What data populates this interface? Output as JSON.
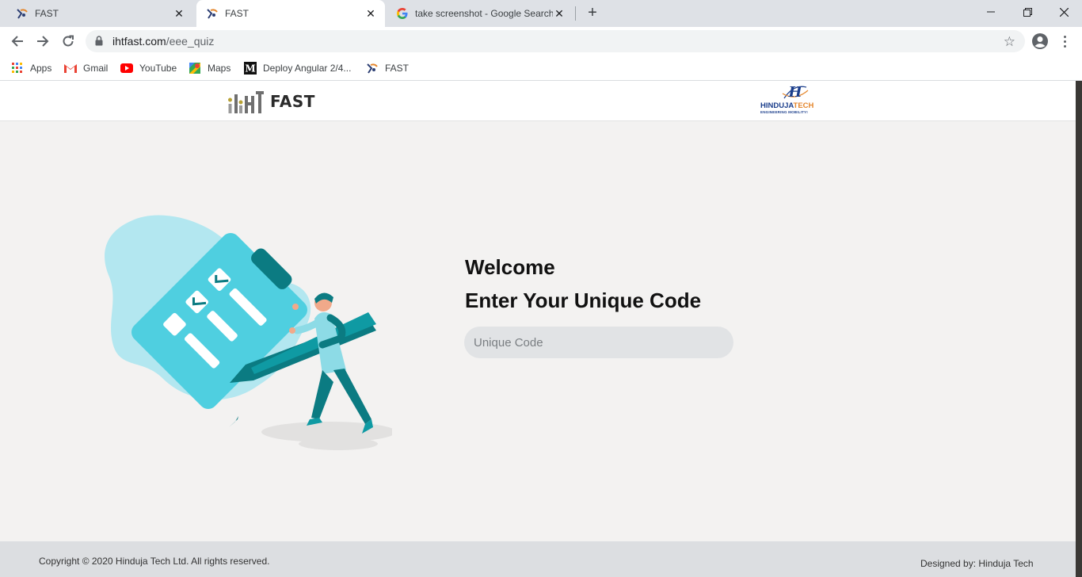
{
  "browser": {
    "tabs": [
      {
        "title": "FAST",
        "favicon": "fast-logo-icon",
        "active": false
      },
      {
        "title": "FAST",
        "favicon": "fast-logo-icon",
        "active": true
      },
      {
        "title": "take screenshot - Google Search",
        "favicon": "google-icon",
        "active": false
      }
    ],
    "close_glyph": "✕",
    "new_tab_glyph": "+",
    "url_domain": "ihtfast.com",
    "url_path": "/eee_quiz",
    "bookmarks": [
      {
        "label": "Apps",
        "icon": "apps-grid-icon"
      },
      {
        "label": "Gmail",
        "icon": "gmail-icon"
      },
      {
        "label": "YouTube",
        "icon": "youtube-icon"
      },
      {
        "label": "Maps",
        "icon": "maps-icon"
      },
      {
        "label": "Deploy Angular 2/4...",
        "icon": "medium-icon"
      },
      {
        "label": "FAST",
        "icon": "fast-logo-icon"
      }
    ]
  },
  "header": {
    "logo_text": "FAST",
    "partner_brand": "HINDUJA",
    "partner_brand_accent": "TECH",
    "partner_tagline": "ENGINEERING MOBILITY!"
  },
  "main": {
    "welcome": "Welcome",
    "subtitle": "Enter Your Unique Code",
    "code_placeholder": "Unique Code",
    "code_value": ""
  },
  "footer": {
    "copyright": "Copyright © 2020 Hinduja Tech Ltd. All rights reserved.",
    "designed_by": "Designed by: Hinduja Tech"
  },
  "colors": {
    "teal_light": "#4fcfe0",
    "teal_dark": "#0b7b82",
    "blob": "#b3e7f0",
    "page_bg": "#f3f2f1",
    "input_bg": "#e1e3e5",
    "brand_blue": "#1c3f8c",
    "brand_orange": "#e4862c"
  }
}
